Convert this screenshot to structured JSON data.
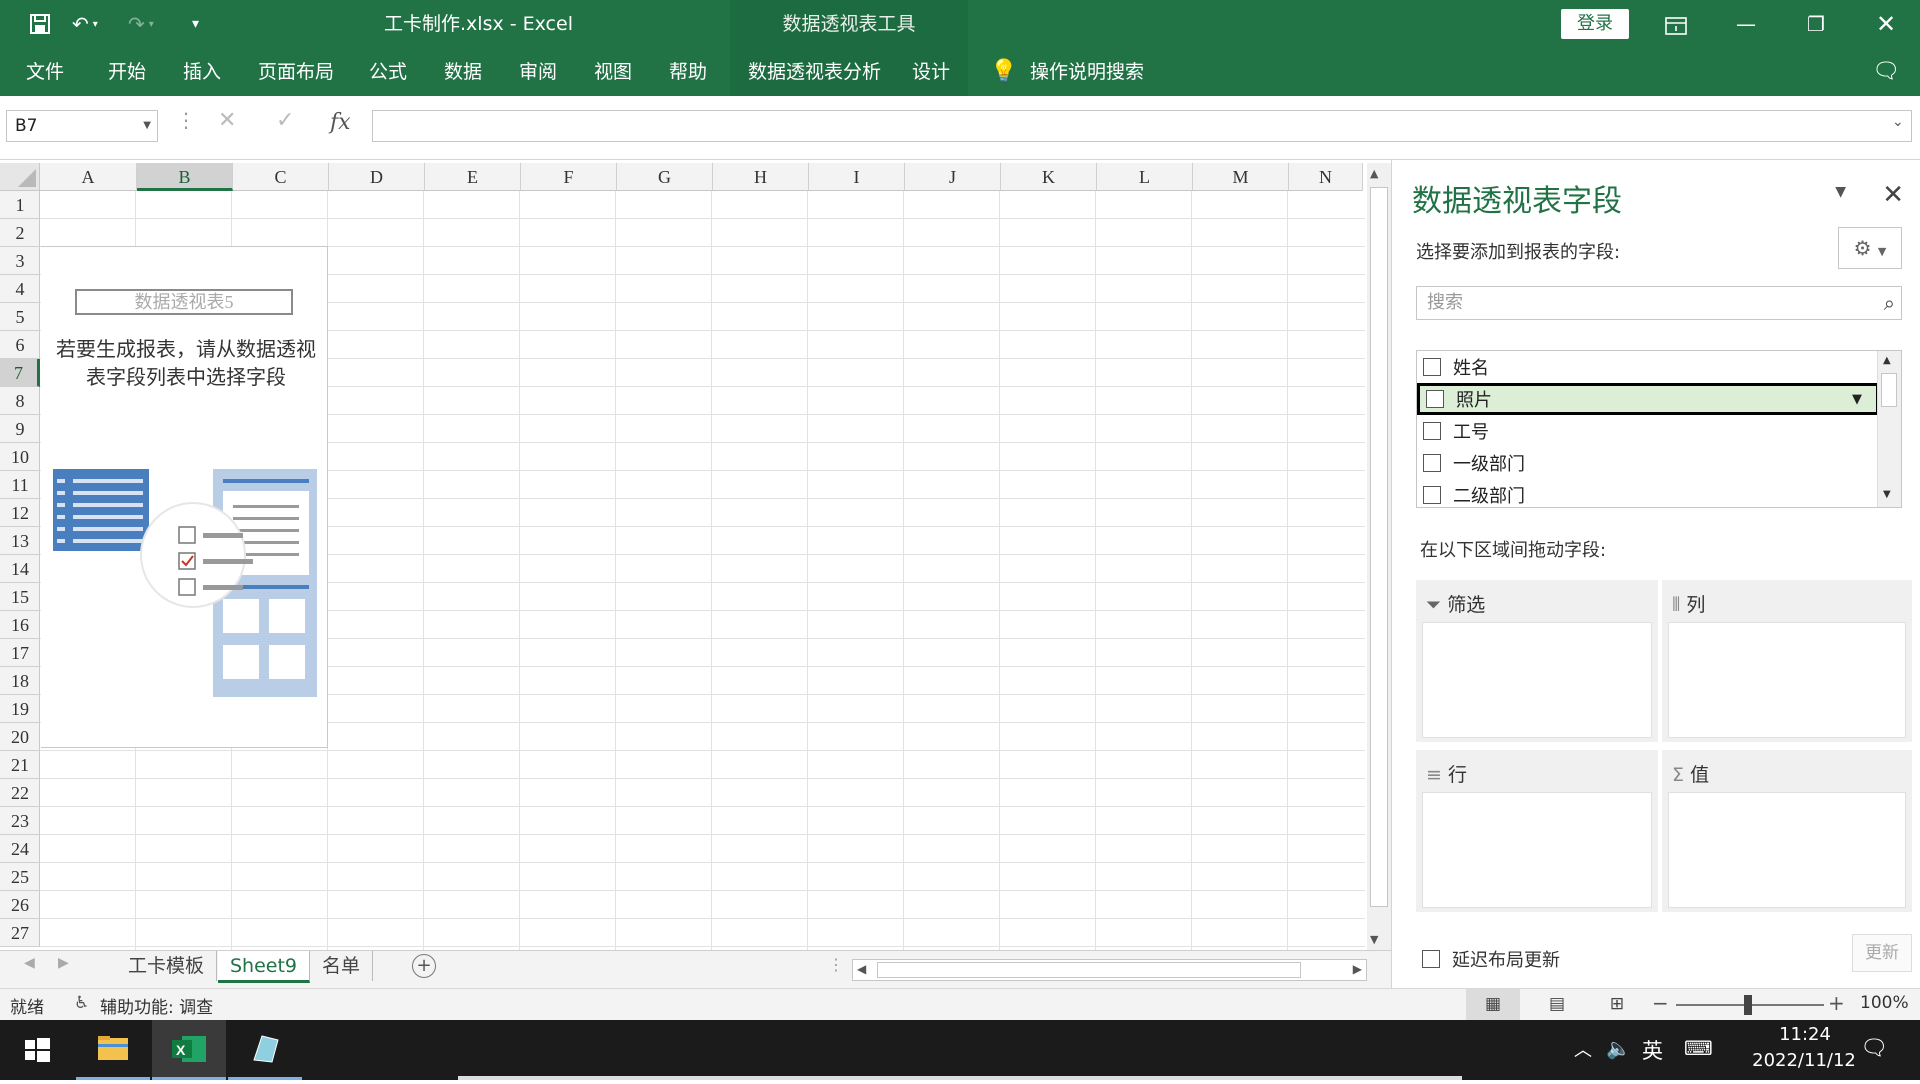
{
  "window": {
    "title": "工卡制作.xlsx  -  Excel",
    "context_tab_group": "数据透视表工具",
    "login_label": "登录"
  },
  "ribbon": {
    "tabs": [
      "文件",
      "开始",
      "插入",
      "页面布局",
      "公式",
      "数据",
      "审阅",
      "视图",
      "帮助",
      "数据透视表分析",
      "设计"
    ],
    "search_label": "操作说明搜索"
  },
  "formula_bar": {
    "name_box": "B7",
    "fx": "fx",
    "value": ""
  },
  "grid": {
    "columns": [
      "A",
      "B",
      "C",
      "D",
      "E",
      "F",
      "G",
      "H",
      "I",
      "J",
      "K",
      "L",
      "M",
      "N"
    ],
    "selected_column": "B",
    "rows": [
      "1",
      "2",
      "3",
      "4",
      "5",
      "6",
      "7",
      "8",
      "9",
      "10",
      "11",
      "12",
      "13",
      "14",
      "15",
      "16",
      "17",
      "18",
      "19",
      "20",
      "21",
      "22",
      "23",
      "24",
      "25",
      "26",
      "27"
    ],
    "selected_row": "7"
  },
  "pivot_placeholder": {
    "name": "数据透视表5",
    "hint": "若要生成报表，请从数据透视表字段列表中选择字段"
  },
  "sheets": {
    "tabs": [
      "工卡模板",
      "Sheet9",
      "名单"
    ],
    "active": "Sheet9"
  },
  "pane": {
    "title": "数据透视表字段",
    "choose_label": "选择要添加到报表的字段:",
    "search_placeholder": "搜索",
    "fields": [
      "姓名",
      "照片",
      "工号",
      "一级部门",
      "二级部门"
    ],
    "selected_field": "照片",
    "drag_label": "在以下区域间拖动字段:",
    "areas": {
      "filter": "筛选",
      "columns": "列",
      "rows": "行",
      "values": "值"
    },
    "defer_label": "延迟布局更新",
    "update_label": "更新"
  },
  "status": {
    "ready": "就绪",
    "accessibility": "辅助功能: 调查",
    "zoom": "100%"
  },
  "taskbar": {
    "time": "11:24",
    "date": "2022/11/12",
    "ime": "英"
  },
  "colors": {
    "excel_green": "#217346",
    "context_green": "#1d6b40"
  }
}
